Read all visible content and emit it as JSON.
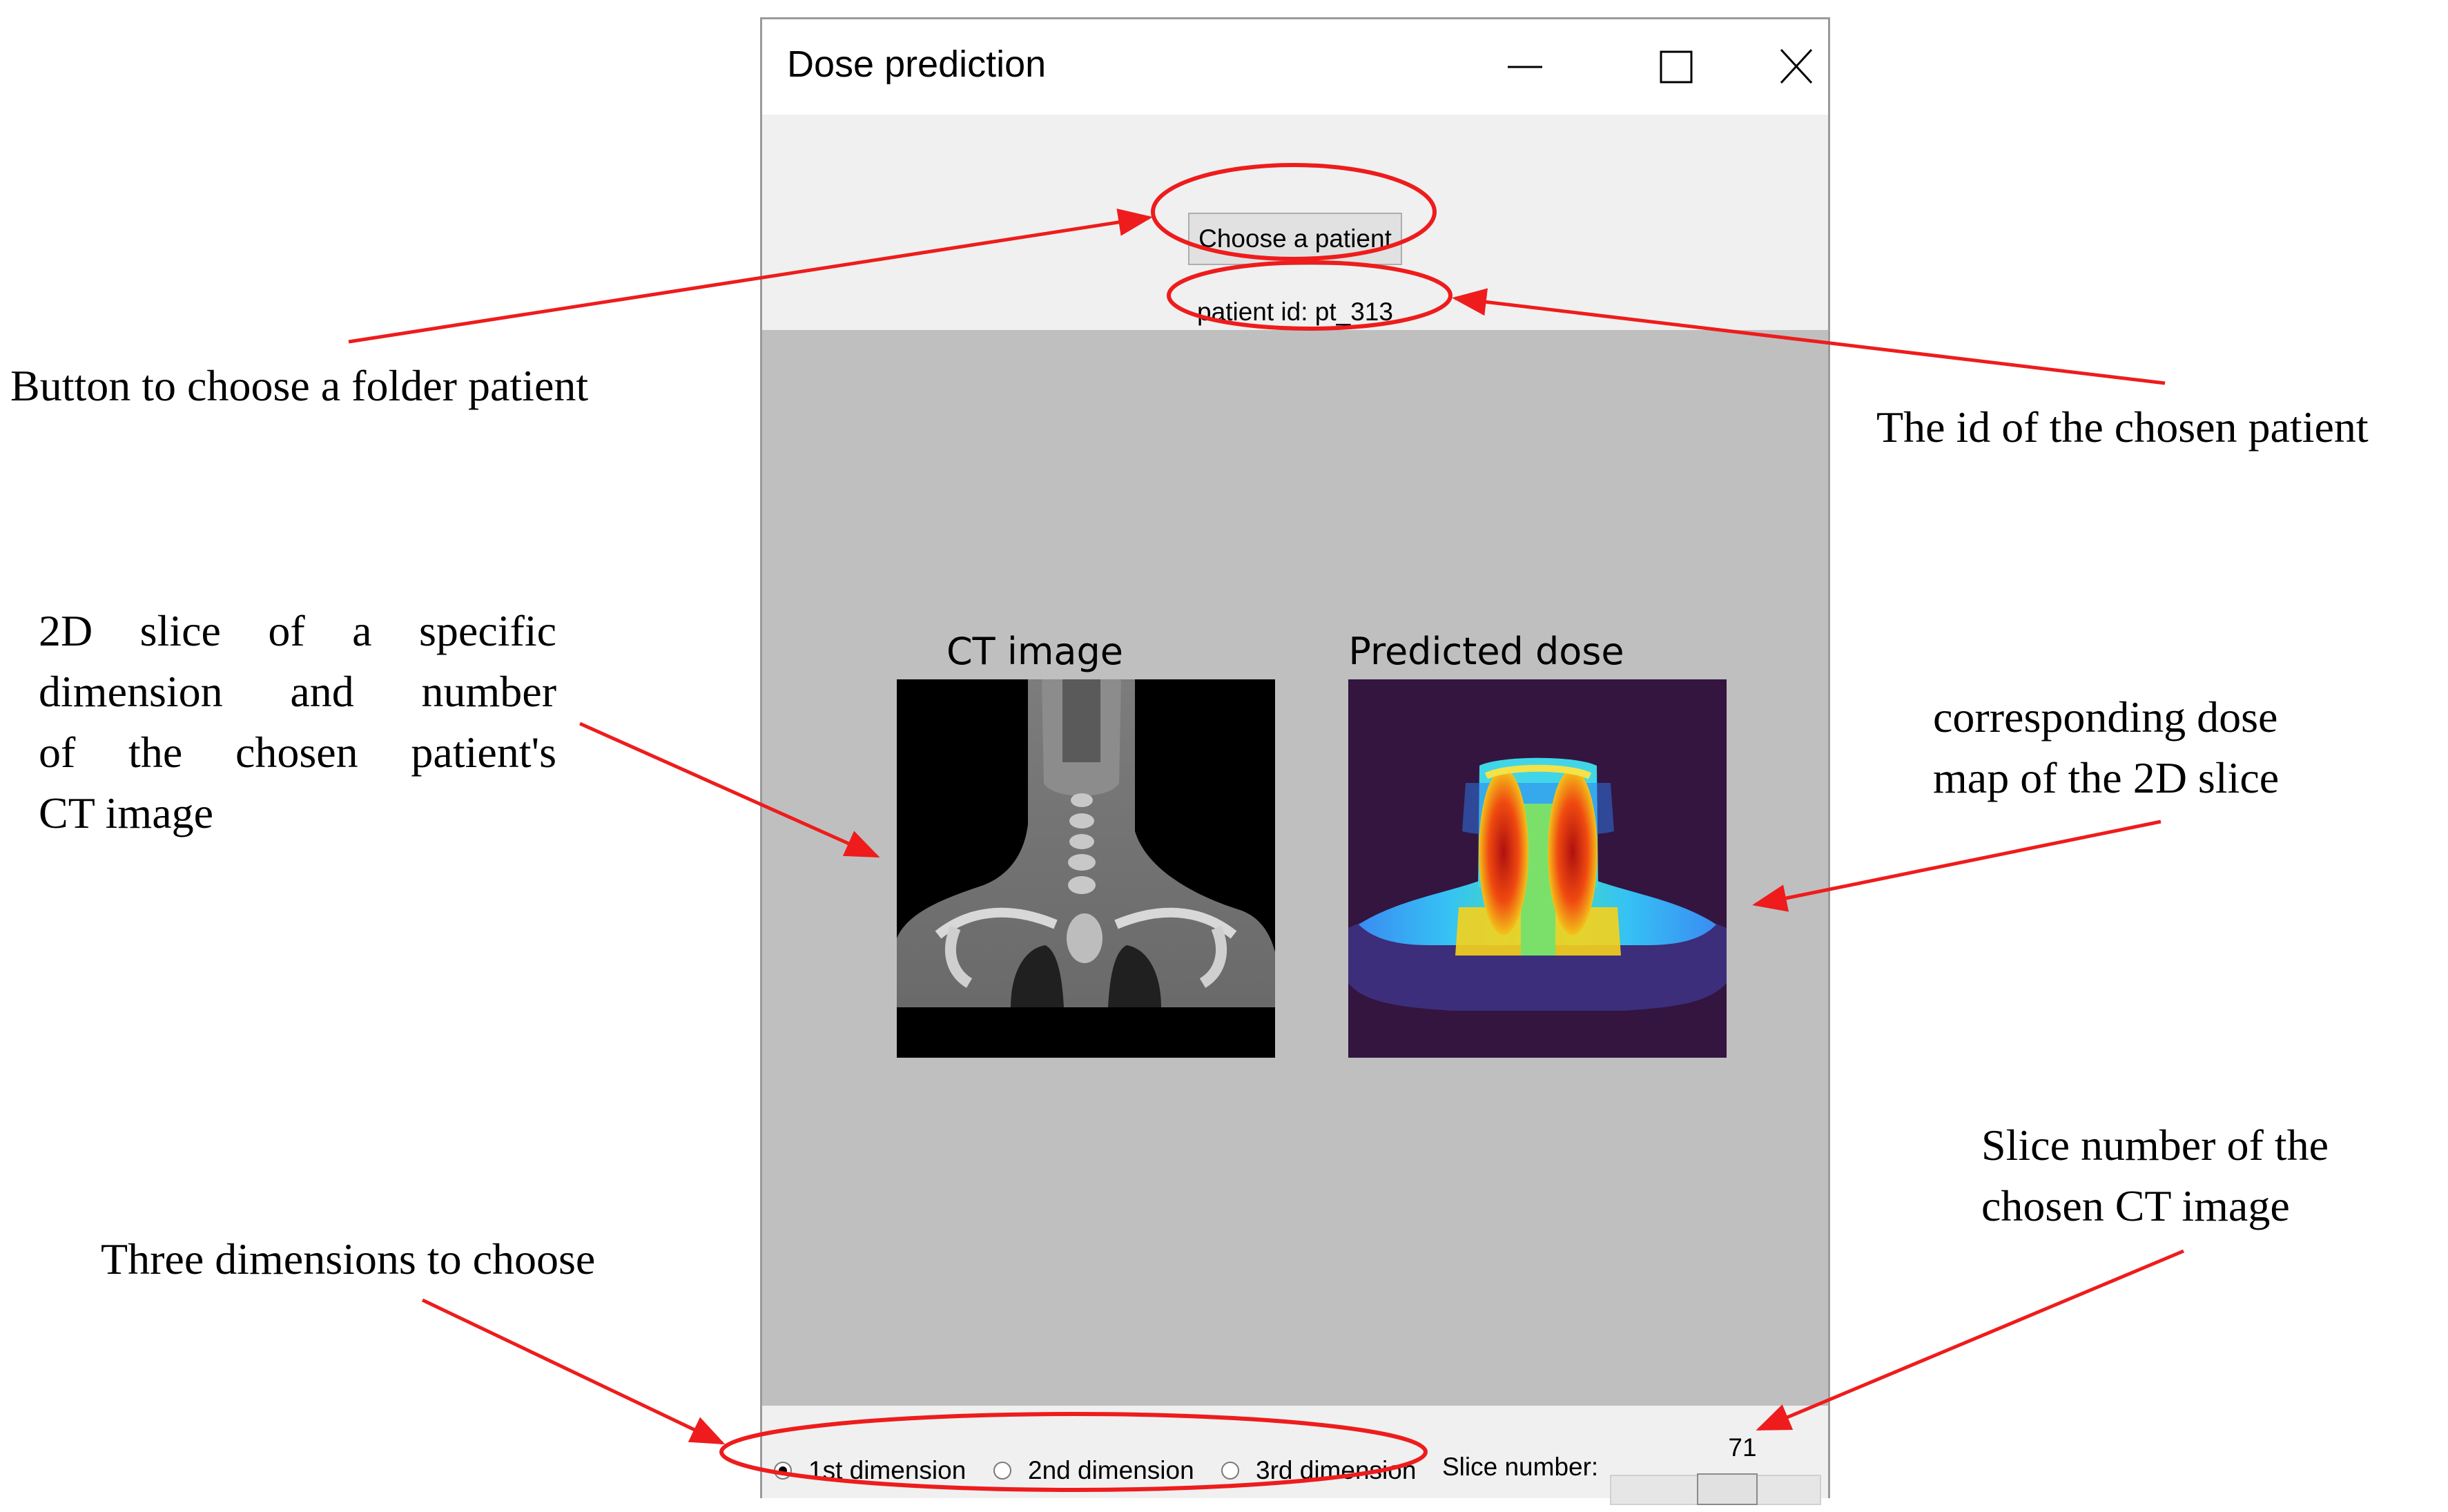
{
  "window": {
    "title": "Dose prediction",
    "controls": [
      "minimize-icon",
      "maximize-icon",
      "close-icon"
    ]
  },
  "top_panel": {
    "choose_button_label": "Choose a patient",
    "patient_id_text": "patient id: pt_313"
  },
  "plots": {
    "ct_title": "CT image",
    "dose_title": "Predicted dose"
  },
  "bottom_bar": {
    "radios": [
      {
        "label": "1st dimension",
        "selected": true
      },
      {
        "label": "2nd dimension",
        "selected": false
      },
      {
        "label": "3rd dimension",
        "selected": false
      }
    ],
    "slice_label": "Slice number:",
    "slice_value": "71",
    "slider_fraction": 0.58
  },
  "annotations": {
    "choose_folder": "Button to choose a folder patient",
    "patient_id": "The id of the chosen patient",
    "slice_2d": [
      "2D slice of a specific",
      "dimension and number",
      "of the chosen patient's",
      "CT image"
    ],
    "dose_map": [
      "corresponding dose",
      "map of the 2D slice"
    ],
    "dimensions": "Three dimensions to choose",
    "slice_number": [
      "Slice number of the",
      "chosen CT image"
    ]
  },
  "colors": {
    "annotation_red": "#ee1c1c",
    "plot_background": "#bfbfbf",
    "dose_background": "#331540"
  }
}
